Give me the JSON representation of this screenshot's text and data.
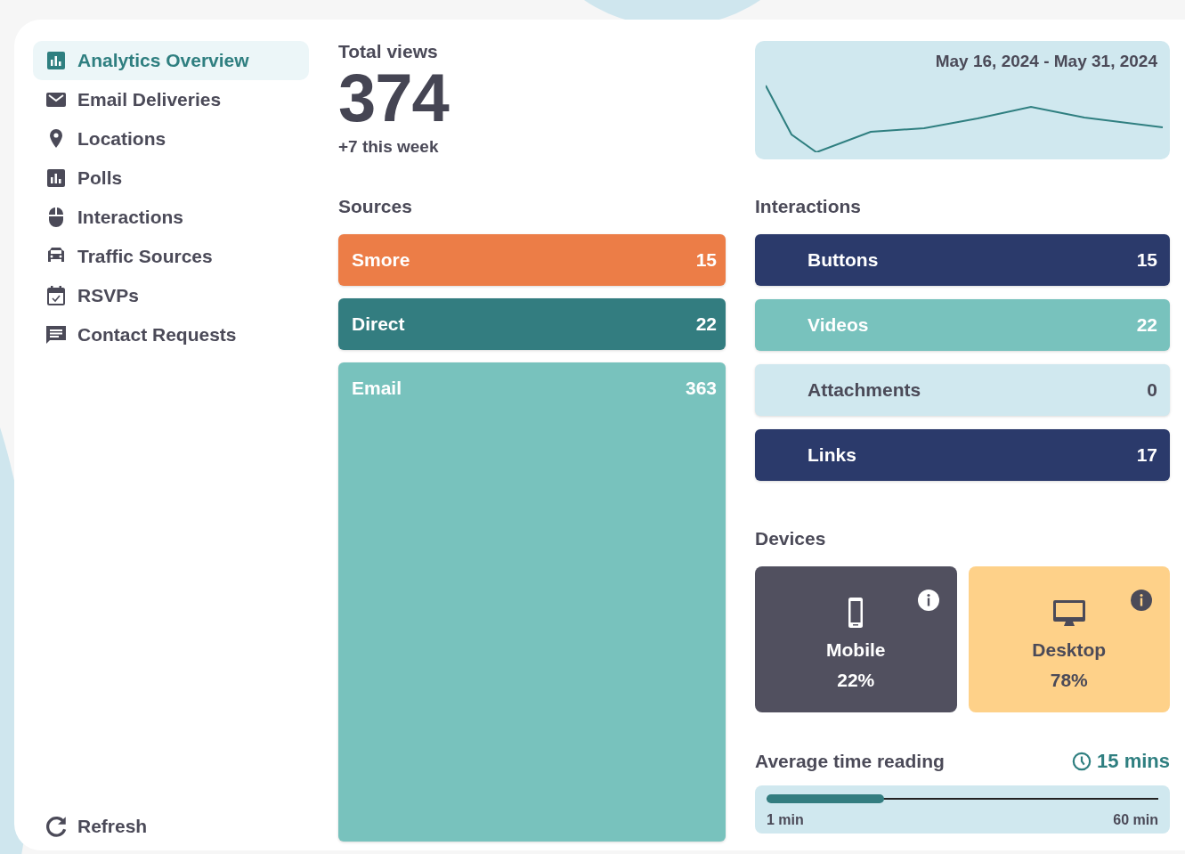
{
  "sidebar": {
    "items": [
      {
        "label": "Analytics Overview",
        "selected": true
      },
      {
        "label": "Email Deliveries",
        "selected": false
      },
      {
        "label": "Locations",
        "selected": false
      },
      {
        "label": "Polls",
        "selected": false
      },
      {
        "label": "Interactions",
        "selected": false
      },
      {
        "label": "Traffic Sources",
        "selected": false
      },
      {
        "label": "RSVPs",
        "selected": false
      },
      {
        "label": "Contact Requests",
        "selected": false
      }
    ],
    "refresh": "Refresh"
  },
  "total_views": {
    "title": "Total views",
    "value": "374",
    "change": "+7 this week"
  },
  "trend": {
    "date_range": "May 16, 2024 - May 31, 2024"
  },
  "sources": {
    "title": "Sources",
    "items": [
      {
        "label": "Smore",
        "count": "15",
        "color": "#ec7d47"
      },
      {
        "label": "Direct",
        "count": "22",
        "color": "#337d80"
      },
      {
        "label": "Email",
        "count": "363",
        "color": "#78c2bd"
      }
    ]
  },
  "interactions": {
    "title": "Interactions",
    "items": [
      {
        "label": "Buttons",
        "count": "15",
        "color": "#2b3a6b"
      },
      {
        "label": "Videos",
        "count": "22",
        "color": "#78c2bd"
      },
      {
        "label": "Attachments",
        "count": "0",
        "color": "#d0e8ef"
      },
      {
        "label": "Links",
        "count": "17",
        "color": "#2b3a6b"
      }
    ]
  },
  "devices": {
    "title": "Devices",
    "items": [
      {
        "kind": "mobile",
        "label": "Mobile",
        "percent": "22%",
        "color": "#51505f"
      },
      {
        "kind": "desktop",
        "label": "Desktop",
        "percent": "78%",
        "color": "#fed189"
      }
    ]
  },
  "reading_time": {
    "title": "Average time reading",
    "value": "15 mins",
    "level": 0.3,
    "min_label": "1 min",
    "max_label": "60 min"
  }
}
